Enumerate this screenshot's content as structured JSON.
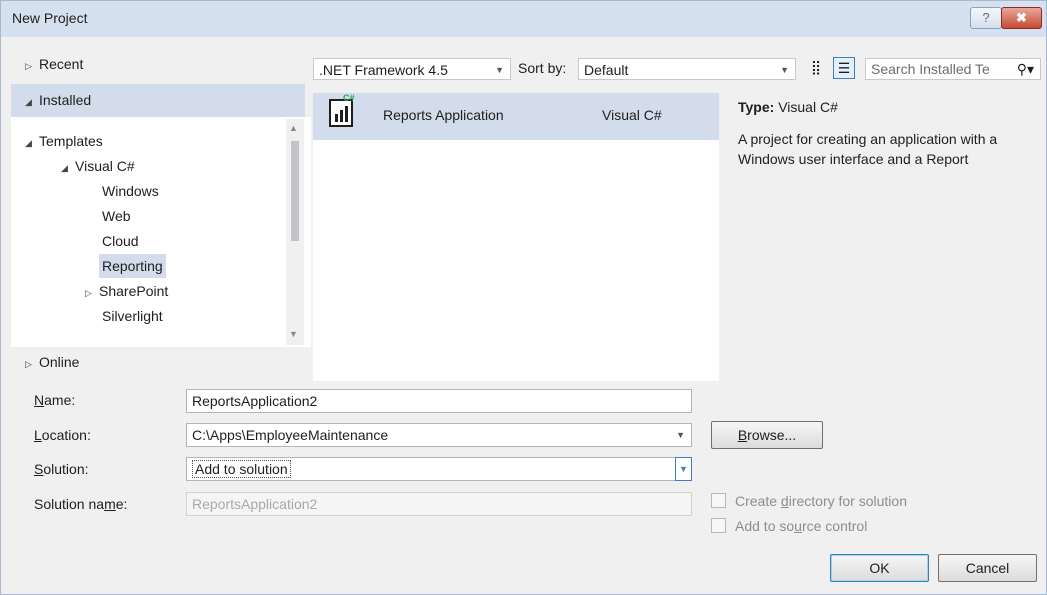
{
  "window": {
    "title": "New Project",
    "help_glyph": "?",
    "close_glyph": "✖"
  },
  "nav": {
    "recent": "Recent",
    "installed": "Installed",
    "templates": "Templates",
    "visual_csharp": "Visual C#",
    "items": [
      "Windows",
      "Web",
      "Cloud",
      "Reporting",
      "SharePoint",
      "Silverlight"
    ],
    "selected": "Reporting",
    "online": "Online"
  },
  "toolbar": {
    "framework": ".NET Framework 4.5",
    "sort_label": "Sort by:",
    "sort_value": "Default",
    "search_placeholder": "Search Installed Te"
  },
  "templates": [
    {
      "name": "Reports Application",
      "language": "Visual C#",
      "icon": "reports-application-icon"
    }
  ],
  "details": {
    "type_label": "Type:",
    "type_value": "Visual C#",
    "description": "A project for creating an application with a Windows user interface and a Report"
  },
  "form": {
    "name_label": "Name:",
    "name_value": "ReportsApplication2",
    "location_label": "Location:",
    "location_value": "C:\\Apps\\EmployeeMaintenance",
    "solution_label": "Solution:",
    "solution_value": "Add to solution",
    "solution_name_label": "Solution name:",
    "solution_name_value": "ReportsApplication2",
    "browse": "Browse...",
    "create_dir": "Create directory for solution",
    "add_source": "Add to source control",
    "ok": "OK",
    "cancel": "Cancel"
  },
  "colors": {
    "selection": "#d3dcea",
    "titlebar": "#d6e1ef",
    "close_red": "#c84a33"
  }
}
